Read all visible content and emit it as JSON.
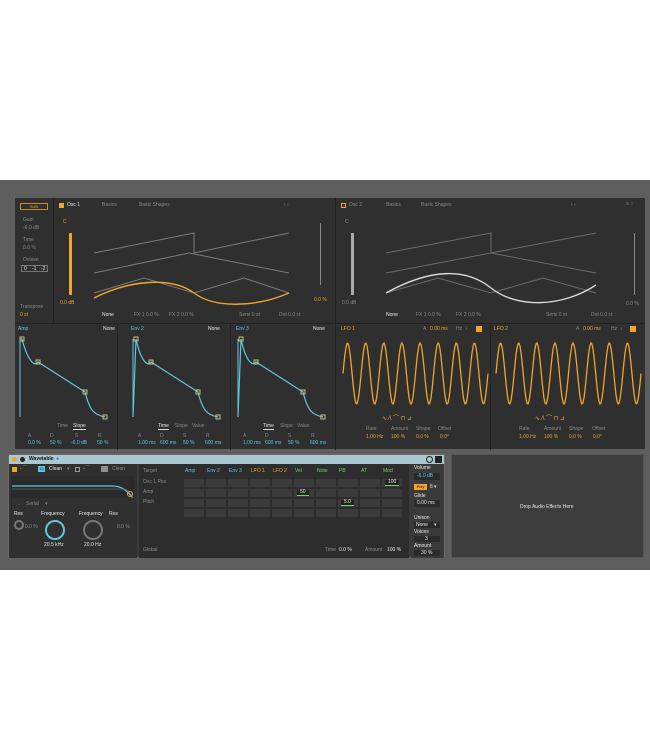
{
  "synth": {
    "sub_button": "SUB",
    "gain_label": "Gain",
    "gain_value": "-6.0 dB",
    "time_label": "Time",
    "time_value": "0.0 %",
    "octave_label": "Octave",
    "octave_options": [
      "0",
      "-1",
      "-2"
    ],
    "transpose_label": "Transpose",
    "transpose_value": "0 st",
    "osc1": {
      "title": "Osc 1",
      "category": "Basics",
      "wavetable": "Basic Shapes",
      "gain": "0.0 dB",
      "mix": "0.0 %",
      "fx_mode": "None",
      "fx1": "FX 1 0.0 %",
      "fx2": "FX 2 0.0 %",
      "semi": "Semi 0 st",
      "det": "Det 0.0 ct"
    },
    "osc2": {
      "title": "Osc 2",
      "category": "Basics",
      "wavetable": "Basic Shapes",
      "gain": "0.0 dB",
      "mix": "0.0 %",
      "fx_mode": "None",
      "fx1": "FX 1 0.0 %",
      "fx2": "FX 2 0.0 %",
      "semi": "Semi 0 st",
      "det": "Det 0.0 ct"
    },
    "amp_env": {
      "title": "Amp",
      "mode": "None",
      "tabs": [
        "Time",
        "Slope"
      ],
      "labels": [
        "A",
        "D",
        "S",
        "R"
      ],
      "values": [
        "0.0 %",
        "50 %",
        "-6.0 dB",
        "50 %"
      ]
    },
    "env2": {
      "title": "Env 2",
      "mode": "None",
      "tabs": [
        "Time",
        "Slope",
        "Value"
      ],
      "labels": [
        "A",
        "D",
        "S",
        "R"
      ],
      "values": [
        "1.00 ms",
        "600 ms",
        "50 %",
        "600 ms"
      ]
    },
    "env3": {
      "title": "Env 3",
      "mode": "None",
      "tabs": [
        "Time",
        "Slope",
        "Value"
      ],
      "labels": [
        "A",
        "D",
        "S",
        "R"
      ],
      "values": [
        "1.00 ms",
        "600 ms",
        "50 %",
        "600 ms"
      ]
    },
    "lfo1": {
      "title": "LFO 1",
      "time": "0.00 ms",
      "hz": "Hz",
      "labels": [
        "Rate",
        "Amount",
        "Shape",
        "Offset"
      ],
      "values": [
        "1.00 Hz",
        "100 %",
        "0.0 %",
        "0.0°"
      ]
    },
    "lfo2": {
      "title": "LFO 2",
      "time": "0.00 ms",
      "hz": "Hz",
      "labels": [
        "Rate",
        "Amount",
        "Shape",
        "Offset"
      ],
      "values": [
        "1.00 Hz",
        "100 %",
        "0.0 %",
        "0.0°"
      ]
    }
  },
  "device": {
    "title": "Wavetable",
    "filter1_mode": "Clean",
    "filter2_mode": "Clean",
    "routing": "Serial",
    "filter1": {
      "res_label": "Res",
      "res_value": "0.0 %",
      "freq_label": "Frequency",
      "freq_value": "20.5 kHz"
    },
    "filter2": {
      "freq_label": "Frequency",
      "res_label": "Res",
      "freq_value": "20.0 Hz",
      "res_value": "0.0 %"
    },
    "matrix": {
      "target_label": "Target",
      "columns": [
        "Amp",
        "Env 2",
        "Env 3",
        "LFO 1",
        "LFO 2",
        "Vel",
        "Note",
        "PB",
        "AT",
        "Mod"
      ],
      "rows": [
        "Osc 1 Pos",
        "Amp",
        "Pitch"
      ],
      "global_label": "Global",
      "time_label": "Time",
      "time_value": "0.0 %",
      "amount_label": "Amount",
      "amount_value": "100 %",
      "cell_values": [
        {
          "row": 0,
          "col": 9,
          "value": "100"
        },
        {
          "row": 1,
          "col": 5,
          "value": "50"
        },
        {
          "row": 2,
          "col": 7,
          "value": "5.0"
        }
      ]
    },
    "voice": {
      "volume_label": "Volume",
      "volume_value": "-6.0 dB",
      "poly": "Poly",
      "voices_count": "8",
      "glide_label": "Glide",
      "glide_value": "0.00 ms",
      "unison_label": "Unison",
      "unison_value": "None",
      "voices_label": "Voices",
      "voices_value": "3",
      "amount_label": "Amount",
      "amount_value": "30 %"
    }
  },
  "drop_zone": {
    "text": "Drop Audio Effects Here"
  },
  "colors": {
    "accent": "#f0a52c",
    "blue": "#5fc6df",
    "panel": "#2f2f2f",
    "frame": "#5e5e5e"
  }
}
